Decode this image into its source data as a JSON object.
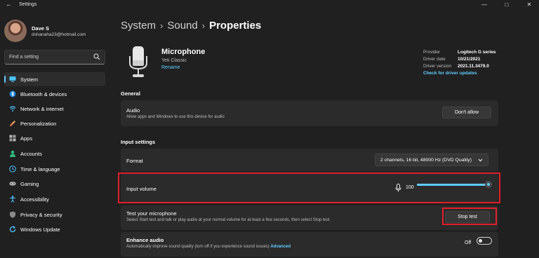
{
  "window": {
    "title": "Settings"
  },
  "user": {
    "name": "Dave S",
    "email": "dshanaha23@hotmail.com"
  },
  "search": {
    "placeholder": "Find a setting"
  },
  "sidebar": {
    "items": [
      {
        "label": "System",
        "icon": "monitor-icon",
        "active": true
      },
      {
        "label": "Bluetooth & devices",
        "icon": "bluetooth-icon"
      },
      {
        "label": "Network & internet",
        "icon": "wifi-icon"
      },
      {
        "label": "Personalization",
        "icon": "brush-icon"
      },
      {
        "label": "Apps",
        "icon": "apps-icon"
      },
      {
        "label": "Accounts",
        "icon": "person-icon"
      },
      {
        "label": "Time & language",
        "icon": "globe-clock-icon"
      },
      {
        "label": "Gaming",
        "icon": "gamepad-icon"
      },
      {
        "label": "Accessibility",
        "icon": "accessibility-icon"
      },
      {
        "label": "Privacy & security",
        "icon": "shield-icon"
      },
      {
        "label": "Windows Update",
        "icon": "update-icon"
      }
    ]
  },
  "breadcrumb": {
    "level1": "System",
    "level2": "Sound",
    "current": "Properties"
  },
  "device": {
    "name": "Microphone",
    "model": "Yeti Classic",
    "rename": "Rename",
    "provider_label": "Provider",
    "provider_value": "Logitech G series",
    "date_label": "Driver date",
    "date_value": "10/21/2021",
    "version_label": "Driver version",
    "version_value": "2021.11.3479.0",
    "driver_link": "Check for driver updates"
  },
  "general": {
    "title": "General",
    "audio_label": "Audio",
    "audio_sub": "Allow apps and Windows to use this device for audio",
    "dont_allow": "Don't allow"
  },
  "input": {
    "title": "Input settings",
    "format_label": "Format",
    "format_value": "2 channels, 16 bit, 48000 Hz (DVD Quality)",
    "volume_label": "Input volume",
    "volume_value": "100",
    "volume_fraction": 1.0,
    "test_label": "Test your microphone",
    "test_sub": "Select Start test and talk or play audio at your normal volume for at least a few seconds, then select Stop test",
    "stop_test": "Stop test",
    "enhance_label": "Enhance audio",
    "enhance_sub": "Automatically improve sound quality (turn off if you experience sound issues)",
    "enhance_link": "Advanced",
    "enhance_state": "Off"
  },
  "colors": {
    "accent": "#60cdff",
    "highlight": "#e0202a",
    "background": "#202020",
    "card": "#2b2b2b"
  }
}
